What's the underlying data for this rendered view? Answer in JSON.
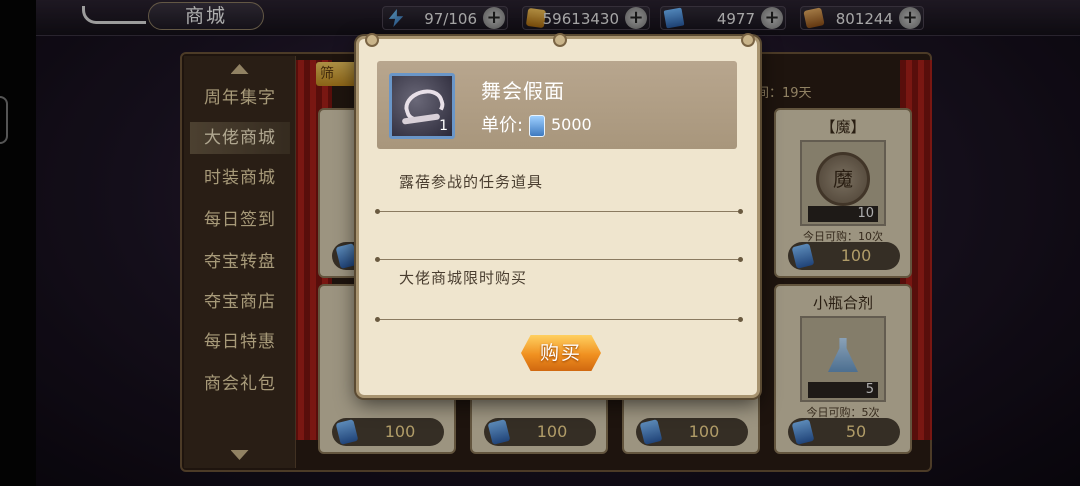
{
  "header": {
    "title": "商城",
    "resources": [
      {
        "icon": "energy-icon",
        "value": "97/106"
      },
      {
        "icon": "gold-icon",
        "value": "59613430"
      },
      {
        "icon": "card-ticket-icon",
        "value": "4977"
      },
      {
        "icon": "bronze-card-icon",
        "value": "801244"
      }
    ],
    "plus_label": "+"
  },
  "sidebar": {
    "items": [
      {
        "label": "周年集字"
      },
      {
        "label": "大佬商城"
      },
      {
        "label": "时装商城"
      },
      {
        "label": "每日签到"
      },
      {
        "label": "夺宝转盘"
      },
      {
        "label": "夺宝商店"
      },
      {
        "label": "每日特惠"
      },
      {
        "label": "商会礼包"
      }
    ],
    "active_index": 1
  },
  "shop": {
    "filter_label": "筛",
    "limit_partial": "间：19天",
    "cards": [
      {
        "name": "【魔】",
        "coin_glyph": "魔",
        "qty": "10",
        "limit": "今日可购：10次",
        "price": "100"
      },
      {
        "name": "小瓶合剂",
        "qty": "5",
        "limit": "今日可购：5次",
        "price": "50"
      }
    ],
    "bottom_prices": [
      "100",
      "100",
      "100"
    ],
    "left_card_price": "100"
  },
  "modal": {
    "item_name": "舞会假面",
    "item_count": "1",
    "price_label": "单价:",
    "price_value": "5000",
    "description_1": "露蓓参战的任务道具",
    "description_2": "大佬商城限时购买",
    "buy_label": "购买"
  },
  "colors": {
    "accent_gold": "#f09020",
    "modal_bg": "#efe5ce",
    "header_bg": "#a8967c"
  }
}
